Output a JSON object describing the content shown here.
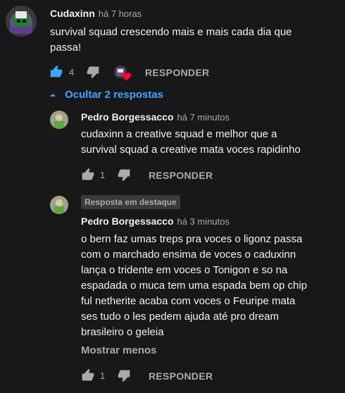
{
  "comment": {
    "author": "Cudaxinn",
    "time": "há 7 horas",
    "text": "survival squad crescendo mais e mais cada dia que passa!",
    "likes": "4",
    "reply_label": "RESPONDER"
  },
  "toggle_replies": "Ocultar 2 respostas",
  "replies": [
    {
      "author": "Pedro Borgessacco",
      "time": "há 7 minutos",
      "text_lines": [
        "cudaxinn a creative squad e melhor que a",
        "survival squad a creative mata voces rapidinho"
      ],
      "likes": "1",
      "reply_label": "RESPONDER"
    },
    {
      "badge": "Resposta em destaque",
      "author": "Pedro Borgessacco",
      "time": "há 3 minutos",
      "text_lines": [
        "o bern faz umas treps pra voces o ligonz passa",
        "com o marchado ensima de voces o caduxinn",
        "lança o tridente em voces o Tonigon e so na",
        "espadada o muca tem uma espada bem op chip",
        "ful netherite acaba com voces o Feuripe mata",
        "ses tudo o les pedem ajuda até pro dream",
        "brasileiro o geleia"
      ],
      "show_less": "Mostrar menos",
      "likes": "1",
      "reply_label": "RESPONDER"
    }
  ],
  "colors": {
    "background": "#181818",
    "link": "#3ea6ff",
    "heart": "#ff0033",
    "like_active": "#3ea6ff"
  }
}
